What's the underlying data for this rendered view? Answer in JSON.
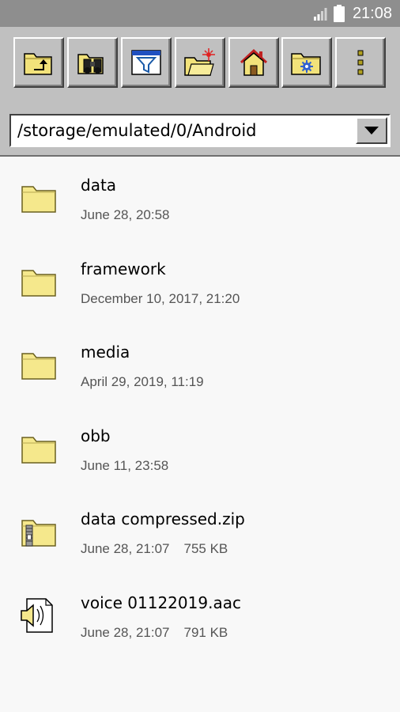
{
  "status_bar": {
    "time": "21:08",
    "icons": [
      "signal-icon",
      "battery-icon"
    ]
  },
  "toolbar": {
    "buttons": [
      {
        "name": "up-folder-button",
        "icon": "folder-up-icon"
      },
      {
        "name": "search-button",
        "icon": "binoculars-icon"
      },
      {
        "name": "filter-button",
        "icon": "filter-icon"
      },
      {
        "name": "new-folder-button",
        "icon": "new-folder-icon"
      },
      {
        "name": "home-button",
        "icon": "home-icon"
      },
      {
        "name": "settings-folder-button",
        "icon": "folder-gear-icon"
      },
      {
        "name": "more-menu-button",
        "icon": "more-vert-icon"
      }
    ]
  },
  "path": {
    "current": "/storage/emulated/0/Android"
  },
  "files": [
    {
      "name": "data",
      "date": "June 28, 20:58",
      "size": "",
      "icon": "folder-icon"
    },
    {
      "name": "framework",
      "date": "December 10, 2017, 21:20",
      "size": "",
      "icon": "folder-icon"
    },
    {
      "name": "media",
      "date": "April 29, 2019, 11:19",
      "size": "",
      "icon": "folder-icon"
    },
    {
      "name": "obb",
      "date": "June 11, 23:58",
      "size": "",
      "icon": "folder-icon"
    },
    {
      "name": "data compressed.zip",
      "date": "June 28, 21:07",
      "size": "755 KB",
      "icon": "zip-folder-icon"
    },
    {
      "name": "voice 01122019.aac",
      "date": "June 28, 21:07",
      "size": "791 KB",
      "icon": "audio-file-icon"
    }
  ],
  "colors": {
    "toolbar_bg": "#c0c0c0",
    "statusbar_bg": "#8e8e8e",
    "folder_yellow": "#f5e88c",
    "list_bg": "#f8f8f8"
  }
}
